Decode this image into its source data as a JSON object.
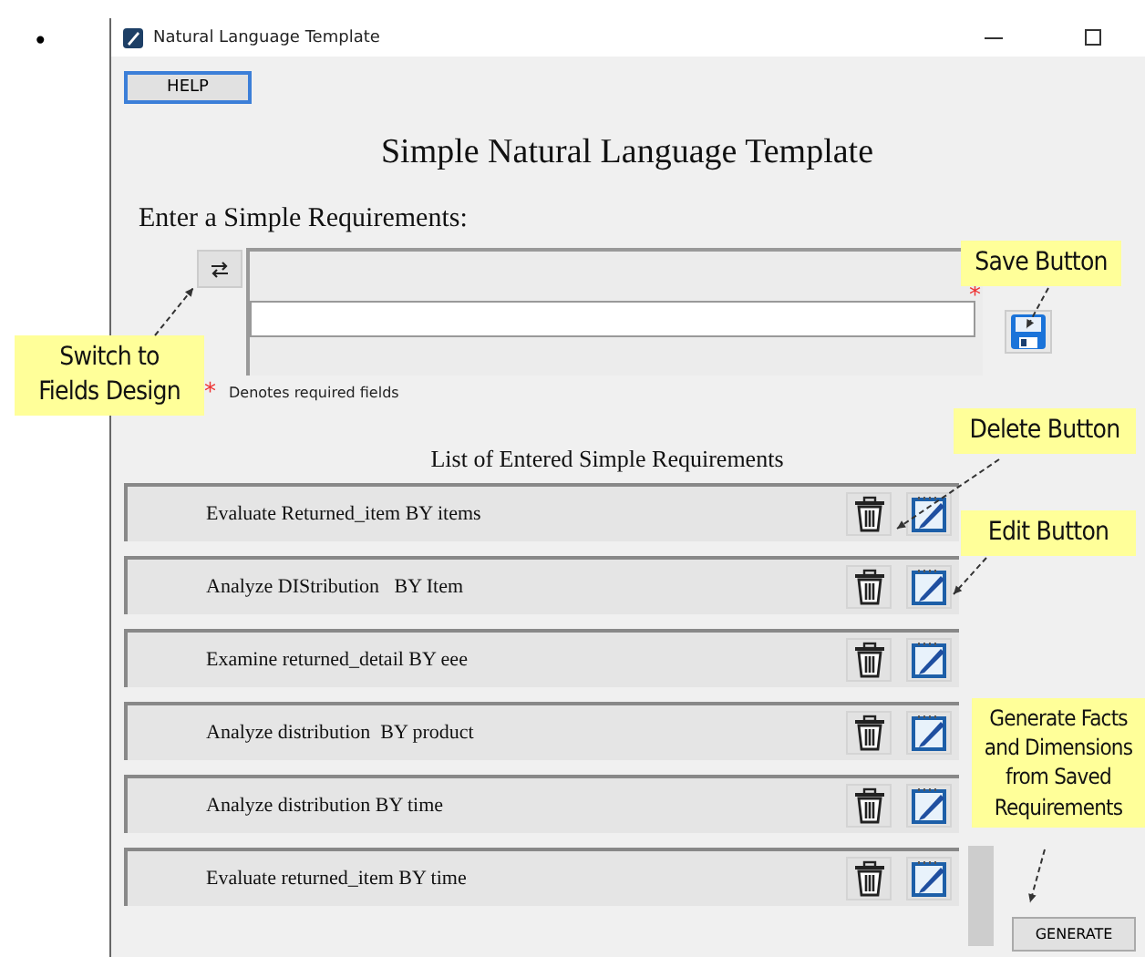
{
  "bullet": "•",
  "window": {
    "title": "Natural Language Template"
  },
  "help_button": "HELP",
  "heading": "Simple Natural Language Template",
  "prompt": "Enter a Simple Requirements:",
  "requirement_field": {
    "required_marker": "*"
  },
  "required_note": {
    "marker": "*",
    "text": "Denotes required fields"
  },
  "list_title": "List of Entered Simple Requirements",
  "requirements": [
    {
      "text": "Evaluate Returned_item BY items"
    },
    {
      "text": "Analyze DIStribution   BY Item"
    },
    {
      "text": "Examine returned_detail BY eee"
    },
    {
      "text": "Analyze distribution  BY product"
    },
    {
      "text": "Analyze distribution BY time"
    },
    {
      "text": "Evaluate returned_item BY time"
    }
  ],
  "generate_button": "GENERATE",
  "annotations": [
    {
      "text": "Switch to\nFields Design"
    },
    {
      "text": "Save Button"
    },
    {
      "text": "Delete Button"
    },
    {
      "text": "Edit Button"
    },
    {
      "text": "Generate Facts\nand Dimensions\nfrom Saved\nRequirements"
    }
  ]
}
